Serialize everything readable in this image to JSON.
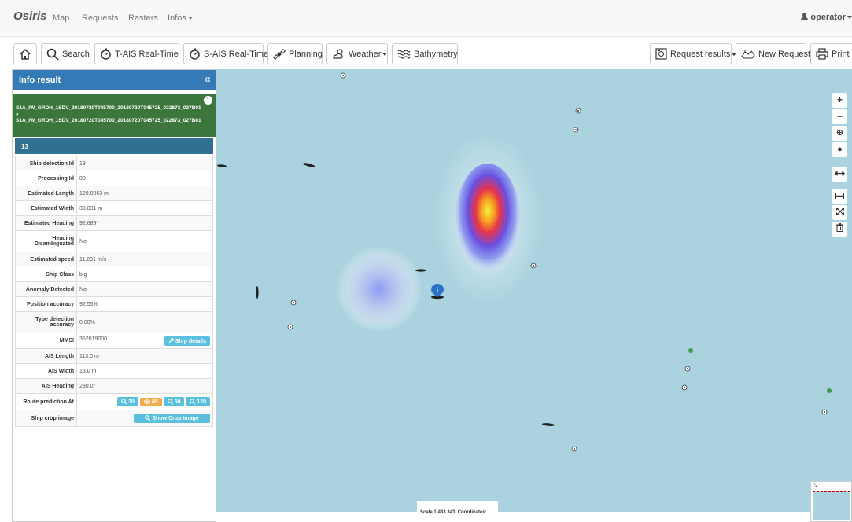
{
  "navbar": {
    "brand": "Osiris",
    "links": [
      "Map",
      "Requests",
      "Rasters",
      "Infos"
    ],
    "user": "operator"
  },
  "toolbar": {
    "search": "Search",
    "tais": "T-AIS Real-Time",
    "sais": "S-AIS Real-Time",
    "planning": "Planning",
    "weather": "Weather",
    "bathymetry": "Bathymetry",
    "request_results": "Request results",
    "new_request": "New Request",
    "print": "Print"
  },
  "panel": {
    "title": "Info result",
    "collapse_glyph": "«",
    "raster_line1": "S1A_IW_GRDH_1SDV_20180720T045700_20180720T045725_022873_027B01",
    "raster_sep": "»",
    "raster_line2": "S1A_IW_GRDH_1SDV_20180720T045700_20180720T045725_022873_027B01",
    "raster_badge": "1",
    "detection_header": "13",
    "rows": [
      {
        "k": "Ship detection Id",
        "v": "13"
      },
      {
        "k": "Processing Id",
        "v": "80"
      },
      {
        "k": "Estimated Length",
        "v": "129.0063 m"
      },
      {
        "k": "Estimated Width",
        "v": "39.831 m"
      },
      {
        "k": "Estimated Heading",
        "v": "92.689°"
      },
      {
        "k": "Heading Disambiguated",
        "v": "No"
      },
      {
        "k": "Estimated speed",
        "v": "11.291 m/s"
      },
      {
        "k": "Ship Class",
        "v": "big"
      },
      {
        "k": "Anomaly Detected",
        "v": "No"
      },
      {
        "k": "Position accuracy",
        "v": "92.55%"
      },
      {
        "k": "Type detection accuracy",
        "v": "0.00%"
      }
    ],
    "mmsi_label": "MMSI",
    "mmsi_value": "352019000",
    "ship_details": "Ship details",
    "ais_rows": [
      {
        "k": "AIS Length",
        "v": "113.0 m"
      },
      {
        "k": "AIS Width",
        "v": "18.0 m"
      },
      {
        "k": "AIS Heading",
        "v": "280.0°"
      }
    ],
    "route_label": "Route prediction At",
    "route_buttons": [
      "30",
      "45",
      "60",
      "120"
    ],
    "crop_label": "Ship crop image",
    "crop_button": "Show Crop Image"
  },
  "map": {
    "scale_label": "Scale 1:433.343",
    "coords_label": "Coordinates:",
    "controls": [
      "+",
      "−",
      "⊕",
      "●"
    ],
    "marker_glyph": "i"
  },
  "colors": {
    "accent": "#337ab7",
    "raster_green": "#3c763d",
    "detection_blue": "#31708f",
    "water": "#aad3df",
    "info_btn": "#5bc0de",
    "warn_btn": "#f0ad4e"
  }
}
